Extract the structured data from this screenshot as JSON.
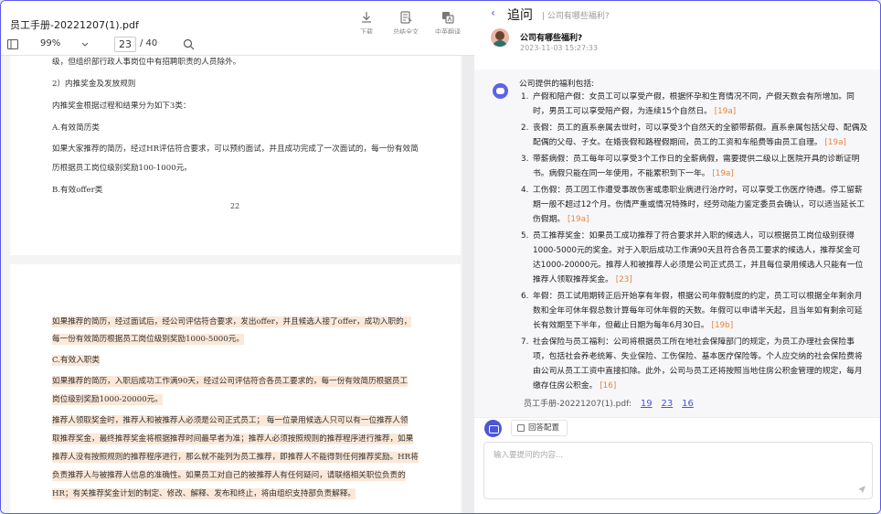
{
  "pdf": {
    "filename": "员工手册-20221207(1).pdf",
    "tools": [
      {
        "icon": "download-icon",
        "label": "下载"
      },
      {
        "icon": "summary-icon",
        "label": "总结全文"
      },
      {
        "icon": "translate-icon",
        "label": "中英翻译"
      }
    ],
    "toolbar": {
      "zoom": "99%",
      "current_page": "23",
      "total_pages": "/ 40"
    },
    "page1": {
      "lines": [
        "级，但组织部行政人事岗位中有招聘职责的人员除外。",
        "2）内推奖金及发放规则",
        "内推奖金根据过程和结果分为如下3类：",
        "A.有效简历类",
        "如果大家推荐的简历，经过HR评估符合要求，可以预约面试，并且成功完成了一次面试的，每一份有效简",
        "历根据员工岗位级别奖励100-1000元。",
        "B.有效offer类"
      ],
      "page_number": "22"
    },
    "page2": {
      "lines": [
        "如果推荐的简历，经过面试后，经公司评估符合要求，发出offer，并且候选人接了offer，成功入职的，",
        "每一份有效简历根据员工岗位级别奖励1000-5000元。",
        "C.有效入职类",
        "如果推荐的简历，入职后成功工作满90天，经过公司评估符合各员工要求的，每一份有效简历根据员工",
        "岗位级别奖励1000-20000元。",
        "推荐人领取奖金时，推荐人和被推荐人必须是公司正式员工；  每一位录用候选人只可以有一位推荐人领",
        "取推荐奖金，最终推荐奖金将根据推荐时间最早者为准；推荐人必须按照规则的推荐程序进行推荐，如果",
        "推荐人没有按照规则的推荐程序进行，那么就不能列为员工推荐，即推荐人不能得到任何推荐奖励。HR将",
        "负责推荐人与被推荐人信息的准确性。如果员工对自己的被推荐人有任何疑问，请联络相关职位负责的",
        "HR；有关推荐奖金计划的制定、修改、解释、发布和终止，将由组织支持部负责解释。"
      ]
    }
  },
  "chat": {
    "back_symbol": "‹",
    "title": "追问",
    "subtitle": "| 公司有哪些福利?",
    "question": "公司有哪些福利?",
    "question_time": "2023-11-03 15:27:33",
    "answer_intro": "公司提供的福利包括:",
    "answer_items": [
      {
        "num": "1.",
        "text": "产假和陪产假：女员工可以享受产假，根据怀孕和生育情况不同，产假天数会有所增加。同时，男员工可以享受陪产假，为连续15个自然日。",
        "cite": "[19a]"
      },
      {
        "num": "2.",
        "text": "丧假：员工的直系亲属去世时，可以享受3个自然天的全额带薪假。直系亲属包括父母、配偶及配偶的父母、子女。在婚丧假和路程假期间，员工的工资和车船费等由员工自理。",
        "cite": "[19a]"
      },
      {
        "num": "3.",
        "text": "带薪病假：员工每年可以享受3个工作日的全薪病假，需要提供二级以上医院开具的诊断证明书。病假只能在同一年使用，不能累积到下一年。",
        "cite": "[19a]"
      },
      {
        "num": "4.",
        "text": "工伤假：员工因工作遭受事故伤害或患职业病进行治疗时，可以享受工伤医疗待遇。停工留薪期一般不超过12个月。伤情严重或情况特殊时，经劳动能力鉴定委员会确认，可以适当延长工伤假期。",
        "cite": "[19a]"
      },
      {
        "num": "5.",
        "text": "员工推荐奖金：如果员工成功推荐了符合要求并入职的候选人，可以根据员工岗位级别获得1000-5000元的奖金。对于入职后成功工作满90天且符合各员工要求的候选人，推荐奖金可达1000-20000元。推荐人和被推荐人必须是公司正式员工，并且每位录用候选人只能有一位推荐人领取推荐奖金。",
        "cite": "[23]"
      },
      {
        "num": "6.",
        "text": "年假：员工试用期转正后开始享有年假，根据公司年假制度的约定，员工可以根据全年剩余月数和全年可休年假总数计算每年可休年假的天数。年假可以申请半天起，且当年如有剩余可延长有效期至下半年，但截止日期为每年6月30日。",
        "cite": "[19b]"
      },
      {
        "num": "7.",
        "text": "社会保险与员工福利：公司将根据员工所在地社会保障部门的规定，为员工办理社会保险事项，包括社会养老统筹、失业保险、工伤保险、基本医疗保险等。个人应交纳的社会保险费将由公司从员工工资中直接扣除。此外，公司与员工还将按照当地住房公积金管理的规定，每月缴存住房公积金。",
        "cite": "[16]"
      }
    ],
    "source_label": "员工手册-20221207(1).pdf:",
    "source_pages": [
      "19",
      "23",
      "16"
    ],
    "config_button": "回答配置",
    "input_placeholder": "输入要提问的内容..."
  }
}
